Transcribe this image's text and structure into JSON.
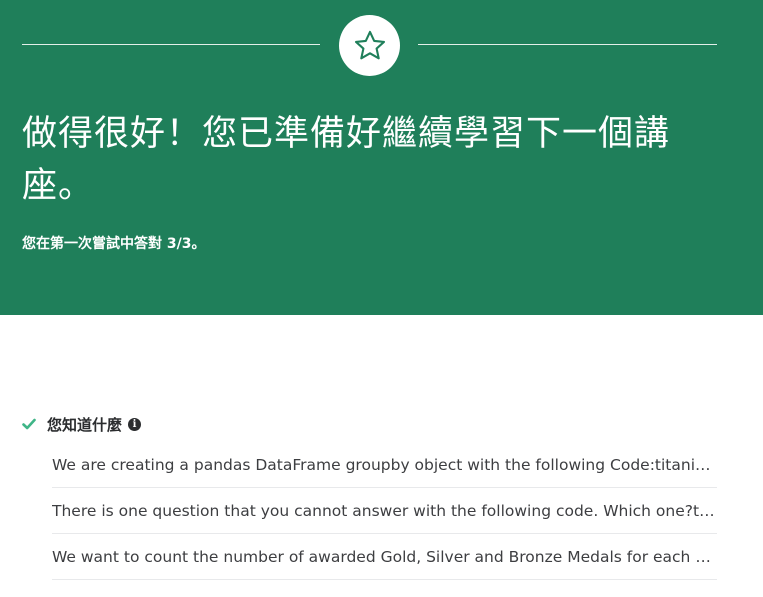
{
  "banner": {
    "icon": "star-icon",
    "headline": "做得很好！您已準備好繼續學習下一個講座。",
    "score_text": "您在第一次嘗試中答對 3/3。",
    "colors": {
      "background": "#1f7f5a",
      "text": "#ffffff",
      "star_stroke": "#1f7f5a"
    }
  },
  "section": {
    "title": "您知道什麼",
    "check_icon": "check-icon",
    "info_icon": "info-icon",
    "colors": {
      "check": "#3fb587"
    }
  },
  "questions": [
    {
      "text": "We are creating  a pandas DataFrame groupby object with the following Code:titanic.groupby(\"sex\")"
    },
    {
      "text": "There is one question that you cannot answer with the following code. Which one?titanic.groupby(\"sex\")"
    },
    {
      "text": "We want to count the number of awarded Gold, Silver and Bronze Medals for each Edition"
    }
  ]
}
